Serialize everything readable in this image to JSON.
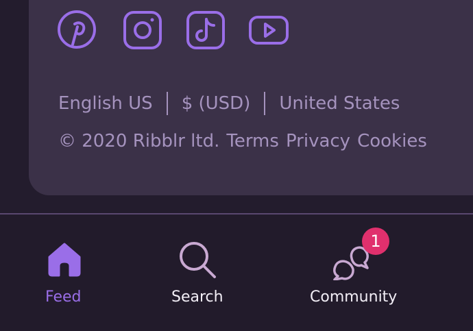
{
  "colors": {
    "accent": "#9a6ee8",
    "muted_text": "#a593be",
    "card": "#3b3148",
    "background": "#231c2d",
    "badge": "#e0306d"
  },
  "social": [
    {
      "name": "pinterest",
      "icon": "pinterest-icon"
    },
    {
      "name": "instagram",
      "icon": "instagram-icon"
    },
    {
      "name": "tiktok",
      "icon": "tiktok-icon"
    },
    {
      "name": "youtube",
      "icon": "youtube-icon"
    }
  ],
  "locale": {
    "language": "English US",
    "currency": "$ (USD)",
    "country": "United States"
  },
  "legal": {
    "copyright": "© 2020 Ribblr ltd.",
    "terms": "Terms",
    "privacy": "Privacy",
    "cookies": "Cookies"
  },
  "nav": {
    "feed": {
      "label": "Feed",
      "icon": "home-icon",
      "active": true
    },
    "search": {
      "label": "Search",
      "icon": "search-icon"
    },
    "community": {
      "label": "Community",
      "icon": "chat-bubbles-icon",
      "badge": "1"
    }
  }
}
